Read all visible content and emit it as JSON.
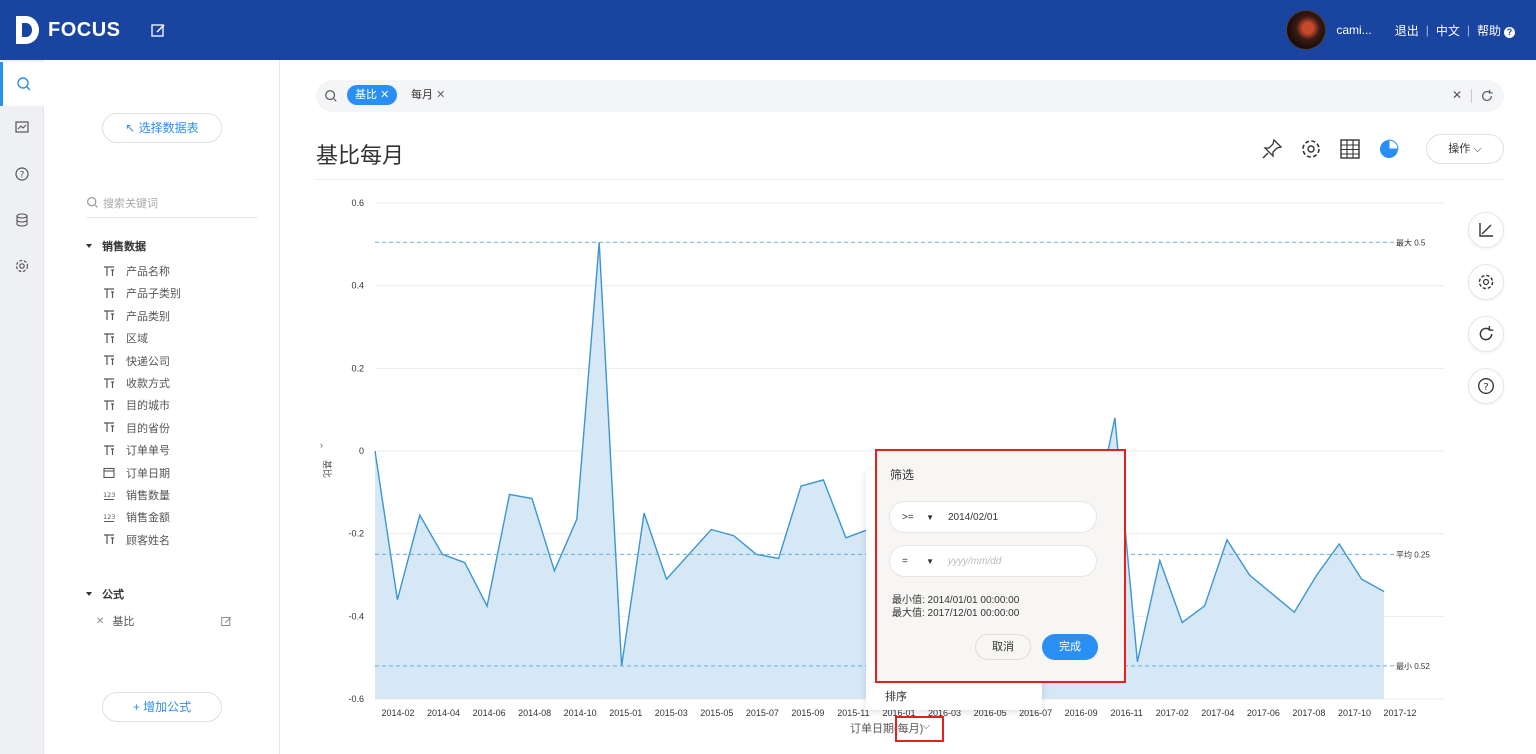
{
  "app": {
    "logo_text": "FOCUS"
  },
  "header": {
    "user_name": "cami...",
    "logout": "退出",
    "language": "中文",
    "help": "帮助"
  },
  "sidebar": {
    "select_table_label": "↖ 选择数据表",
    "search_placeholder": "搜索关键词",
    "section_sales": "销售数据",
    "fields": [
      {
        "label": "产品名称",
        "icon": "text-field-icon"
      },
      {
        "label": "产品子类别",
        "icon": "text-field-icon"
      },
      {
        "label": "产品类别",
        "icon": "text-field-icon"
      },
      {
        "label": "区域",
        "icon": "text-field-icon"
      },
      {
        "label": "快递公司",
        "icon": "text-field-icon"
      },
      {
        "label": "收款方式",
        "icon": "text-field-icon"
      },
      {
        "label": "目的城市",
        "icon": "text-field-icon"
      },
      {
        "label": "目的省份",
        "icon": "text-field-icon"
      },
      {
        "label": "订单单号",
        "icon": "text-field-icon"
      },
      {
        "label": "订单日期",
        "icon": "date-field-icon"
      },
      {
        "label": "销售数量",
        "icon": "number-field-icon"
      },
      {
        "label": "销售金额",
        "icon": "number-field-icon"
      },
      {
        "label": "顾客姓名",
        "icon": "text-field-icon"
      }
    ],
    "section_formula": "公式",
    "formula_item": "基比",
    "add_formula_label": "+ 增加公式"
  },
  "search": {
    "tags": [
      "基比",
      "每月"
    ]
  },
  "page": {
    "title": "基比每月",
    "operate_label": "操作"
  },
  "axis_caption": "订单日期(每月)",
  "filter_popup": {
    "title": "筛选",
    "row1_operator": ">=",
    "row1_value": "2014/02/01",
    "row2_operator": "=",
    "row2_placeholder": "yyyy/mm/dd",
    "min_text": "最小值: 2014/01/01 00:00:00",
    "max_text": "最大值: 2017/12/01 00:00:00",
    "cancel": "取消",
    "done": "完成",
    "sort_label": "排序"
  },
  "colors": {
    "header": "#1944a0",
    "accent": "#2a8ff4",
    "line": "#3b96d1",
    "area": "#d6e8f5",
    "highlight": "#e8201a"
  },
  "chart_data": {
    "type": "area",
    "ylabel": "基比",
    "ylim": [
      -0.6,
      0.6
    ],
    "yticks": [
      0.6,
      0.4,
      0.2,
      0,
      -0.2,
      -0.4,
      -0.6
    ],
    "xtick_labels": [
      "2014-02",
      "2014-04",
      "2014-06",
      "2014-08",
      "2014-10",
      "2015-01",
      "2015-03",
      "2015-05",
      "2015-07",
      "2015-09",
      "2015-11",
      "2016-01",
      "2016-03",
      "2016-05",
      "2016-07",
      "2016-09",
      "2016-11",
      "2017-02",
      "2017-04",
      "2017-06",
      "2017-08",
      "2017-10",
      "2017-12"
    ],
    "values": [
      0.0,
      -0.36,
      -0.155,
      -0.25,
      -0.27,
      -0.375,
      -0.105,
      -0.115,
      -0.29,
      -0.165,
      0.505,
      -0.52,
      -0.15,
      -0.31,
      -0.25,
      -0.19,
      -0.205,
      -0.25,
      -0.26,
      -0.085,
      -0.07,
      -0.21,
      -0.19,
      -0.2,
      -0.22,
      -0.25,
      -0.27,
      -0.3,
      -0.26,
      -0.24,
      -0.22,
      -0.2,
      -0.18,
      0.08,
      -0.51,
      -0.265,
      -0.415,
      -0.375,
      -0.215,
      -0.3,
      -0.345,
      -0.39,
      -0.3,
      -0.225,
      -0.31,
      -0.34
    ],
    "reference_lines": [
      {
        "label": "最大 0.5",
        "value": 0.505
      },
      {
        "label": "平均 0.25",
        "value": -0.25
      },
      {
        "label": "最小 0.52",
        "value": -0.52
      }
    ]
  }
}
